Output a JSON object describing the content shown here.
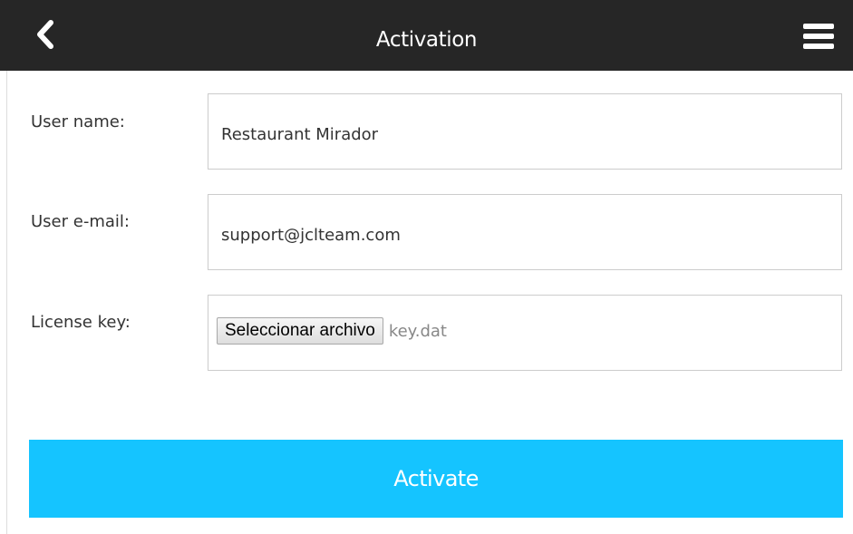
{
  "header": {
    "title": "Activation",
    "back_icon": "chevron-left-icon",
    "menu_icon": "hamburger-menu-icon",
    "background_color": "#262626"
  },
  "form": {
    "user_name": {
      "label": "User name:",
      "value": "Restaurant Mirador"
    },
    "user_email": {
      "label": "User e-mail:",
      "value": "support@jclteam.com"
    },
    "license_key": {
      "label": "License key:",
      "button_label": "Seleccionar archivo",
      "file_name": "key.dat"
    }
  },
  "activate_button": {
    "label": "Activate",
    "color": "#15c4ff"
  }
}
